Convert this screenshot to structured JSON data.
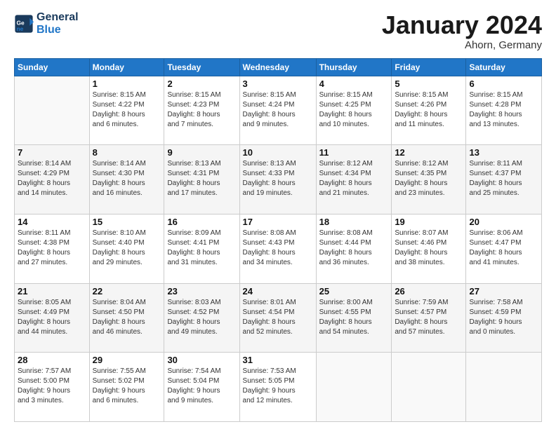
{
  "header": {
    "logo_line1": "General",
    "logo_line2": "Blue",
    "title": "January 2024",
    "subtitle": "Ahorn, Germany"
  },
  "weekdays": [
    "Sunday",
    "Monday",
    "Tuesday",
    "Wednesday",
    "Thursday",
    "Friday",
    "Saturday"
  ],
  "weeks": [
    [
      {
        "day": "",
        "info": ""
      },
      {
        "day": "1",
        "info": "Sunrise: 8:15 AM\nSunset: 4:22 PM\nDaylight: 8 hours\nand 6 minutes."
      },
      {
        "day": "2",
        "info": "Sunrise: 8:15 AM\nSunset: 4:23 PM\nDaylight: 8 hours\nand 7 minutes."
      },
      {
        "day": "3",
        "info": "Sunrise: 8:15 AM\nSunset: 4:24 PM\nDaylight: 8 hours\nand 9 minutes."
      },
      {
        "day": "4",
        "info": "Sunrise: 8:15 AM\nSunset: 4:25 PM\nDaylight: 8 hours\nand 10 minutes."
      },
      {
        "day": "5",
        "info": "Sunrise: 8:15 AM\nSunset: 4:26 PM\nDaylight: 8 hours\nand 11 minutes."
      },
      {
        "day": "6",
        "info": "Sunrise: 8:15 AM\nSunset: 4:28 PM\nDaylight: 8 hours\nand 13 minutes."
      }
    ],
    [
      {
        "day": "7",
        "info": "Sunrise: 8:14 AM\nSunset: 4:29 PM\nDaylight: 8 hours\nand 14 minutes."
      },
      {
        "day": "8",
        "info": "Sunrise: 8:14 AM\nSunset: 4:30 PM\nDaylight: 8 hours\nand 16 minutes."
      },
      {
        "day": "9",
        "info": "Sunrise: 8:13 AM\nSunset: 4:31 PM\nDaylight: 8 hours\nand 17 minutes."
      },
      {
        "day": "10",
        "info": "Sunrise: 8:13 AM\nSunset: 4:33 PM\nDaylight: 8 hours\nand 19 minutes."
      },
      {
        "day": "11",
        "info": "Sunrise: 8:12 AM\nSunset: 4:34 PM\nDaylight: 8 hours\nand 21 minutes."
      },
      {
        "day": "12",
        "info": "Sunrise: 8:12 AM\nSunset: 4:35 PM\nDaylight: 8 hours\nand 23 minutes."
      },
      {
        "day": "13",
        "info": "Sunrise: 8:11 AM\nSunset: 4:37 PM\nDaylight: 8 hours\nand 25 minutes."
      }
    ],
    [
      {
        "day": "14",
        "info": "Sunrise: 8:11 AM\nSunset: 4:38 PM\nDaylight: 8 hours\nand 27 minutes."
      },
      {
        "day": "15",
        "info": "Sunrise: 8:10 AM\nSunset: 4:40 PM\nDaylight: 8 hours\nand 29 minutes."
      },
      {
        "day": "16",
        "info": "Sunrise: 8:09 AM\nSunset: 4:41 PM\nDaylight: 8 hours\nand 31 minutes."
      },
      {
        "day": "17",
        "info": "Sunrise: 8:08 AM\nSunset: 4:43 PM\nDaylight: 8 hours\nand 34 minutes."
      },
      {
        "day": "18",
        "info": "Sunrise: 8:08 AM\nSunset: 4:44 PM\nDaylight: 8 hours\nand 36 minutes."
      },
      {
        "day": "19",
        "info": "Sunrise: 8:07 AM\nSunset: 4:46 PM\nDaylight: 8 hours\nand 38 minutes."
      },
      {
        "day": "20",
        "info": "Sunrise: 8:06 AM\nSunset: 4:47 PM\nDaylight: 8 hours\nand 41 minutes."
      }
    ],
    [
      {
        "day": "21",
        "info": "Sunrise: 8:05 AM\nSunset: 4:49 PM\nDaylight: 8 hours\nand 44 minutes."
      },
      {
        "day": "22",
        "info": "Sunrise: 8:04 AM\nSunset: 4:50 PM\nDaylight: 8 hours\nand 46 minutes."
      },
      {
        "day": "23",
        "info": "Sunrise: 8:03 AM\nSunset: 4:52 PM\nDaylight: 8 hours\nand 49 minutes."
      },
      {
        "day": "24",
        "info": "Sunrise: 8:01 AM\nSunset: 4:54 PM\nDaylight: 8 hours\nand 52 minutes."
      },
      {
        "day": "25",
        "info": "Sunrise: 8:00 AM\nSunset: 4:55 PM\nDaylight: 8 hours\nand 54 minutes."
      },
      {
        "day": "26",
        "info": "Sunrise: 7:59 AM\nSunset: 4:57 PM\nDaylight: 8 hours\nand 57 minutes."
      },
      {
        "day": "27",
        "info": "Sunrise: 7:58 AM\nSunset: 4:59 PM\nDaylight: 9 hours\nand 0 minutes."
      }
    ],
    [
      {
        "day": "28",
        "info": "Sunrise: 7:57 AM\nSunset: 5:00 PM\nDaylight: 9 hours\nand 3 minutes."
      },
      {
        "day": "29",
        "info": "Sunrise: 7:55 AM\nSunset: 5:02 PM\nDaylight: 9 hours\nand 6 minutes."
      },
      {
        "day": "30",
        "info": "Sunrise: 7:54 AM\nSunset: 5:04 PM\nDaylight: 9 hours\nand 9 minutes."
      },
      {
        "day": "31",
        "info": "Sunrise: 7:53 AM\nSunset: 5:05 PM\nDaylight: 9 hours\nand 12 minutes."
      },
      {
        "day": "",
        "info": ""
      },
      {
        "day": "",
        "info": ""
      },
      {
        "day": "",
        "info": ""
      }
    ]
  ]
}
